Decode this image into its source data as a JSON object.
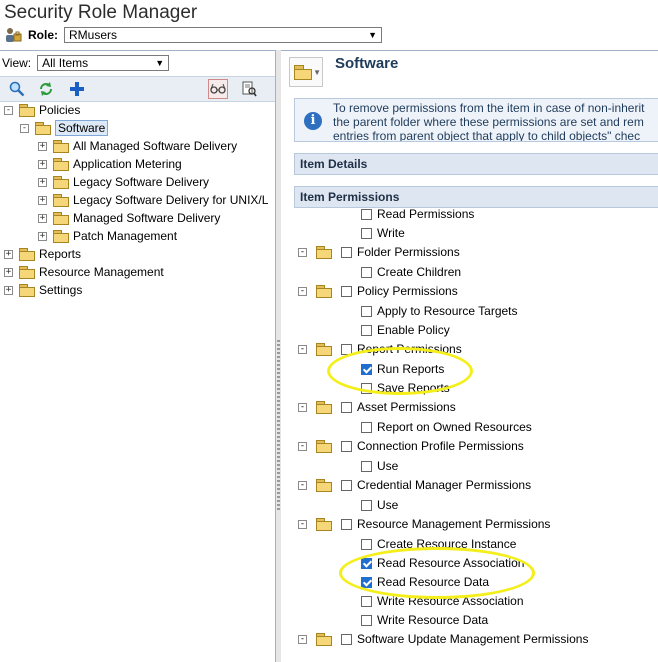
{
  "app": {
    "title": "Security Role Manager"
  },
  "role": {
    "label": "Role:",
    "value": "RMusers"
  },
  "left_panel": {
    "view_label": "View:",
    "view_value": "All Items",
    "toolbar": [
      {
        "icon": "search-icon",
        "glyph": "🔍"
      },
      {
        "icon": "refresh-icon",
        "glyph": "⟳"
      },
      {
        "icon": "add-icon",
        "glyph": "✚"
      },
      {
        "icon": "glasses-icon",
        "glyph": "👓"
      },
      {
        "icon": "find-document-icon",
        "glyph": "📋"
      }
    ],
    "tree": [
      {
        "label": "Policies",
        "expander": "-"
      },
      {
        "label": "Software",
        "expander": "-"
      },
      {
        "label": "All Managed Software Delivery",
        "expander": "+"
      },
      {
        "label": "Application Metering",
        "expander": "+"
      },
      {
        "label": "Legacy Software Delivery",
        "expander": "+"
      },
      {
        "label": "Legacy Software Delivery for UNIX/L",
        "expander": "+"
      },
      {
        "label": "Managed Software Delivery",
        "expander": "+"
      },
      {
        "label": "Patch Management",
        "expander": "+"
      },
      {
        "label": "Reports",
        "expander": "+"
      },
      {
        "label": "Resource Management",
        "expander": "+"
      },
      {
        "label": "Settings",
        "expander": "+"
      }
    ]
  },
  "right_panel": {
    "title": "Software",
    "info_lines": [
      "To remove permissions from the item in case of non-inherit",
      "the parent folder where these permissions are set and rem",
      "entries from parent object that apply to child objects\" chec"
    ],
    "item_details": "Item Details",
    "item_permissions": "Item Permissions",
    "permissions": [
      {
        "label": "Read Permissions",
        "checked": false
      },
      {
        "label": "Write",
        "checked": false
      },
      {
        "label": "Folder Permissions",
        "checked": false
      },
      {
        "label": "Create Children",
        "checked": false
      },
      {
        "label": "Policy Permissions",
        "checked": false
      },
      {
        "label": "Apply to Resource Targets",
        "checked": false
      },
      {
        "label": "Enable Policy",
        "checked": false
      },
      {
        "label": "Report Permissions",
        "checked": false
      },
      {
        "label": "Run Reports",
        "checked": true
      },
      {
        "label": "Save Reports",
        "checked": false
      },
      {
        "label": "Asset Permissions",
        "checked": false
      },
      {
        "label": "Report on Owned Resources",
        "checked": false
      },
      {
        "label": "Connection Profile Permissions",
        "checked": false
      },
      {
        "label": "Use",
        "checked": false
      },
      {
        "label": "Credential Manager Permissions",
        "checked": false
      },
      {
        "label": "Use",
        "checked": false
      },
      {
        "label": "Resource Management Permissions",
        "checked": false
      },
      {
        "label": "Create Resource Instance",
        "checked": false
      },
      {
        "label": "Read Resource Association",
        "checked": true
      },
      {
        "label": "Read Resource Data",
        "checked": true
      },
      {
        "label": "Write Resource Association",
        "checked": false
      },
      {
        "label": "Write Resource Data",
        "checked": false
      },
      {
        "label": "Software Update Management Permissions",
        "checked": false
      }
    ]
  },
  "colors": {
    "highlight": "#f4ee1a",
    "accent": "#1f6fd1",
    "panel_header": "#dde6f1"
  }
}
